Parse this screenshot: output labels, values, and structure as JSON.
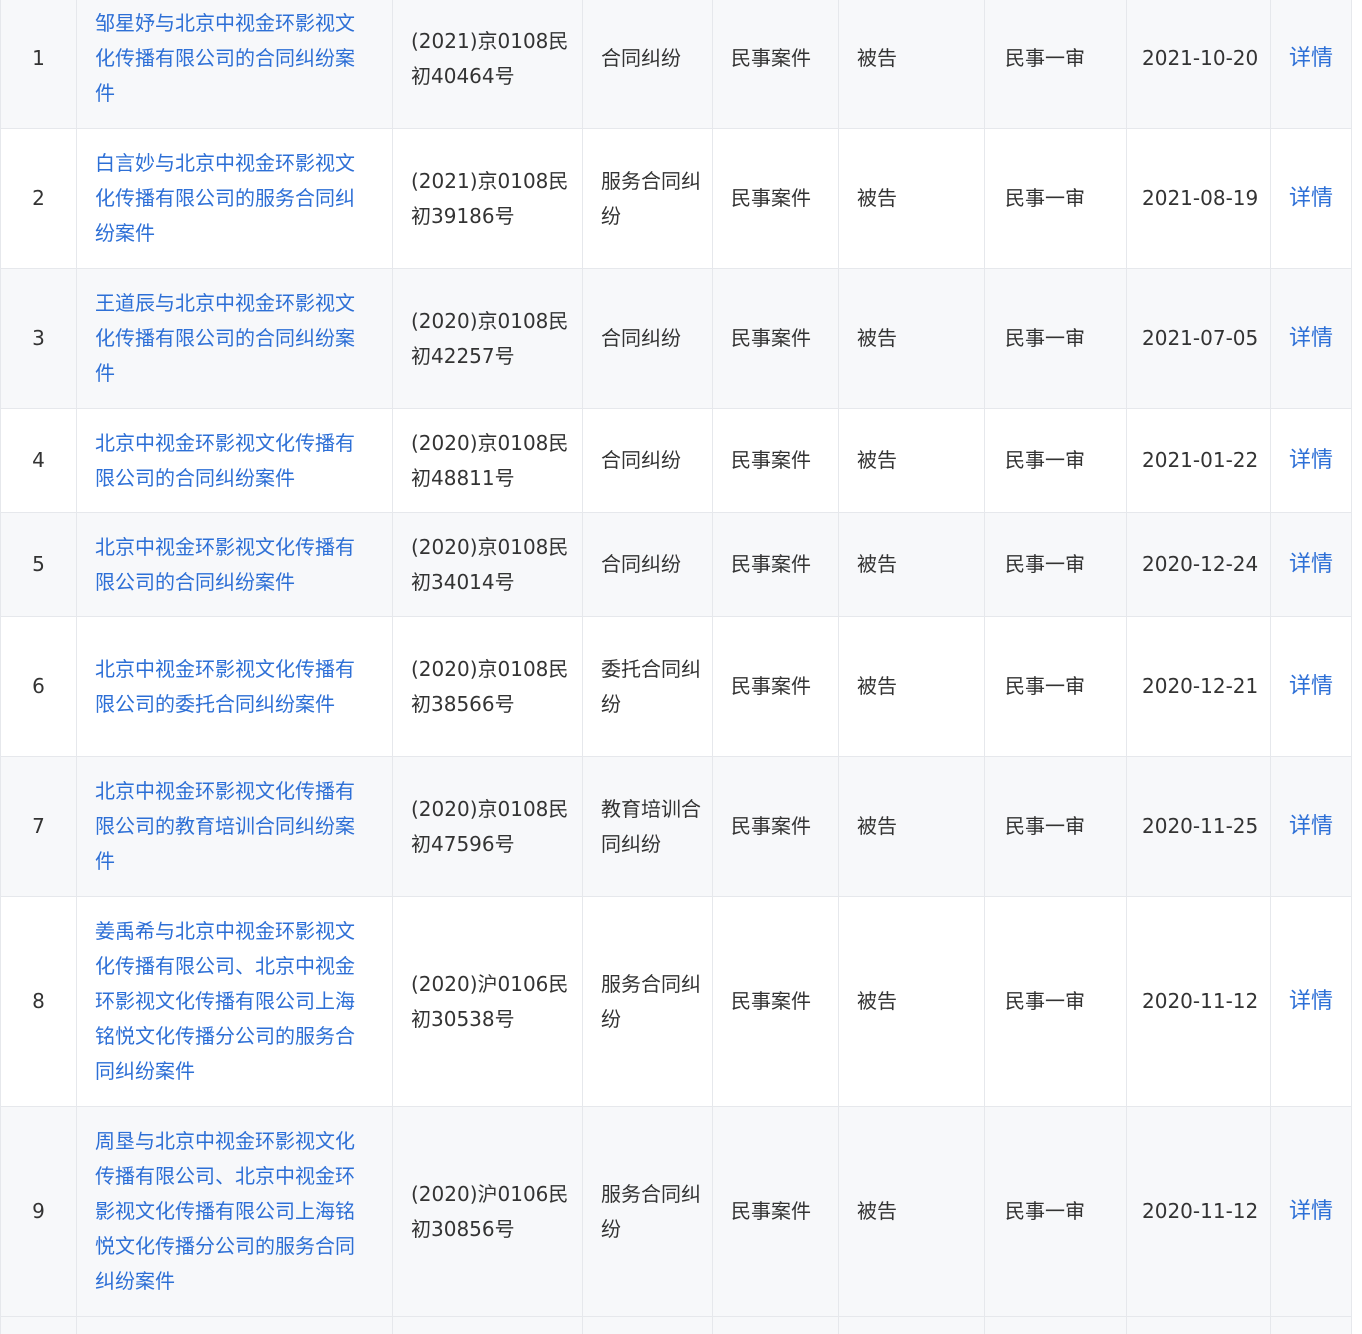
{
  "colors": {
    "link": "#2d6fd6",
    "text": "#333333",
    "border": "#e6e8ec",
    "row_alt": "#f7f8fa"
  },
  "rows": [
    {
      "index": "1",
      "title": "邹星妤与北京中视金环影视文化传播有限公司的合同纠纷案件",
      "case_no": "(2021)京0108民初40464号",
      "cause": "合同纠纷",
      "case_type": "民事案件",
      "role": "被告",
      "trial": "民事一审",
      "date": "2021-10-20",
      "detail": "详情"
    },
    {
      "index": "2",
      "title": "白言妙与北京中视金环影视文化传播有限公司的服务合同纠纷案件",
      "case_no": "(2021)京0108民初39186号",
      "cause": "服务合同纠纷",
      "case_type": "民事案件",
      "role": "被告",
      "trial": "民事一审",
      "date": "2021-08-19",
      "detail": "详情"
    },
    {
      "index": "3",
      "title": "王道辰与北京中视金环影视文化传播有限公司的合同纠纷案件",
      "case_no": "(2020)京0108民初42257号",
      "cause": "合同纠纷",
      "case_type": "民事案件",
      "role": "被告",
      "trial": "民事一审",
      "date": "2021-07-05",
      "detail": "详情"
    },
    {
      "index": "4",
      "title": "北京中视金环影视文化传播有限公司的合同纠纷案件",
      "case_no": "(2020)京0108民初48811号",
      "cause": "合同纠纷",
      "case_type": "民事案件",
      "role": "被告",
      "trial": "民事一审",
      "date": "2021-01-22",
      "detail": "详情"
    },
    {
      "index": "5",
      "title": "北京中视金环影视文化传播有限公司的合同纠纷案件",
      "case_no": "(2020)京0108民初34014号",
      "cause": "合同纠纷",
      "case_type": "民事案件",
      "role": "被告",
      "trial": "民事一审",
      "date": "2020-12-24",
      "detail": "详情"
    },
    {
      "index": "6",
      "title": "北京中视金环影视文化传播有限公司的委托合同纠纷案件",
      "case_no": "(2020)京0108民初38566号",
      "cause": "委托合同纠纷",
      "case_type": "民事案件",
      "role": "被告",
      "trial": "民事一审",
      "date": "2020-12-21",
      "detail": "详情"
    },
    {
      "index": "7",
      "title": "北京中视金环影视文化传播有限公司的教育培训合同纠纷案件",
      "case_no": "(2020)京0108民初47596号",
      "cause": "教育培训合同纠纷",
      "case_type": "民事案件",
      "role": "被告",
      "trial": "民事一审",
      "date": "2020-11-25",
      "detail": "详情"
    },
    {
      "index": "8",
      "title": "姜禹希与北京中视金环影视文化传播有限公司、北京中视金环影视文化传播有限公司上海铭悦文化传播分公司的服务合同纠纷案件",
      "case_no": "(2020)沪0106民初30538号",
      "cause": "服务合同纠纷",
      "case_type": "民事案件",
      "role": "被告",
      "trial": "民事一审",
      "date": "2020-11-12",
      "detail": "详情"
    },
    {
      "index": "9",
      "title": "周垦与北京中视金环影视文化传播有限公司、北京中视金环影视文化传播有限公司上海铭悦文化传播分公司的服务合同纠纷案件",
      "case_no": "(2020)沪0106民初30856号",
      "cause": "服务合同纠纷",
      "case_type": "民事案件",
      "role": "被告",
      "trial": "民事一审",
      "date": "2020-11-12",
      "detail": "详情"
    }
  ]
}
